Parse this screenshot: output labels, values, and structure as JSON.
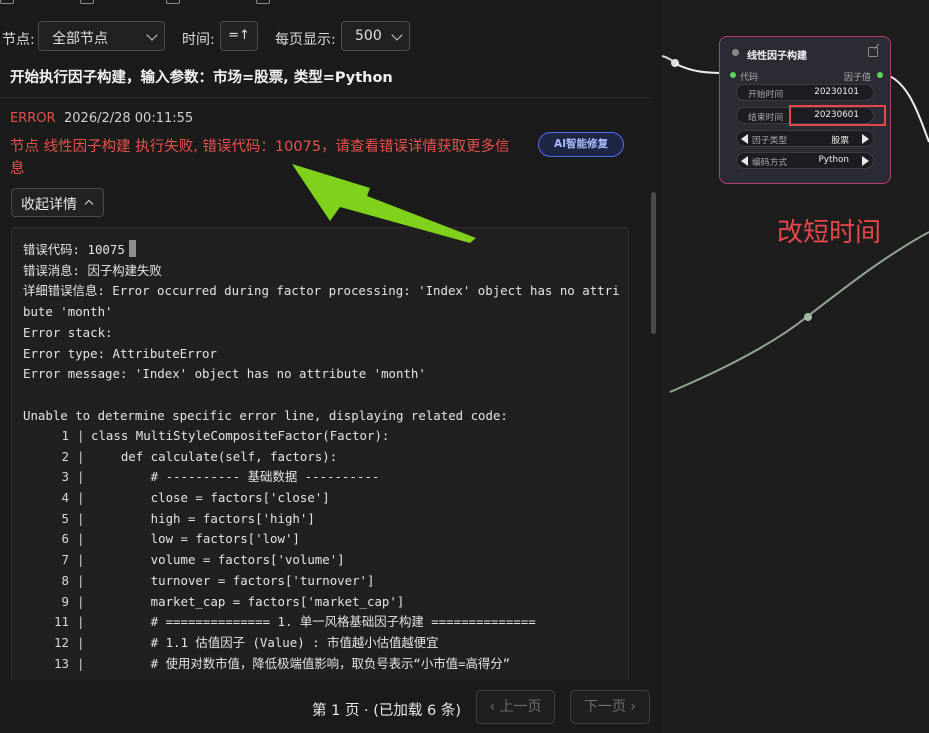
{
  "filter_bar": {
    "node_label": "节点:",
    "node_select_value": "全部节点",
    "time_label": "时间:",
    "sort_icon_text": "=↑",
    "page_size_label": "每页显示:",
    "page_size_value": "500"
  },
  "log": {
    "header_text": "开始执行因子构建，输入参数：市场=股票, 类型=Python",
    "error": {
      "level": "ERROR",
      "timestamp": "2026/2/28 00:11:55",
      "message": "节点 线性因子构建 执行失败, 错误代码：10075，请查看错误详情获取更多信息",
      "ai_fix_label": "AI智能修复",
      "collapse_label": "收起详情"
    },
    "detail_text": "错误代码: 10075\n错误消息: 因子构建失败\n详细错误信息: Error occurred during factor processing: 'Index' object has no attribute 'month'\nError stack:\nError type: AttributeError\nError message: 'Index' object has no attribute 'month'\n\nUnable to determine specific error line, displaying related code:",
    "code_lines": [
      {
        "n": "1",
        "code": "class MultiStyleCompositeFactor(Factor):"
      },
      {
        "n": "2",
        "code": "    def calculate(self, factors):"
      },
      {
        "n": "3",
        "code": "        # ---------- 基础数据 ----------"
      },
      {
        "n": "4",
        "code": "        close = factors['close']"
      },
      {
        "n": "5",
        "code": "        high = factors['high']"
      },
      {
        "n": "6",
        "code": "        low = factors['low']"
      },
      {
        "n": "7",
        "code": "        volume = factors['volume']"
      },
      {
        "n": "8",
        "code": "        turnover = factors['turnover']"
      },
      {
        "n": "9",
        "code": "        market_cap = factors['market_cap']"
      },
      {
        "n": "11",
        "code": "        # ============== 1. 单一风格基础因子构建 =============="
      },
      {
        "n": "12",
        "code": "        # 1.1 估值因子 (Value) : 市值越小估值越便宜"
      },
      {
        "n": "13",
        "code": "        # 使用对数市值，降低极端值影响，取负号表示“小市值=高得分”"
      }
    ]
  },
  "pager": {
    "page_info": "第 1 页 · (已加载 6 条)",
    "prev_label": "‹ 上一页",
    "next_label": "下一页 ›"
  },
  "node": {
    "title": "线性因子构建",
    "input_port": "代码",
    "output_port": "因子值",
    "rows": [
      {
        "label": "开始时间",
        "value": "20230101"
      },
      {
        "label": "结束时间",
        "value": "20230601"
      },
      {
        "label": "因子类型",
        "value": "股票"
      },
      {
        "label": "编码方式",
        "value": "Python"
      }
    ]
  },
  "annotation_text": "改短时间",
  "colors": {
    "error_red": "#e6514c",
    "node_border": "#b33a78",
    "arrow_green": "#7fd11c",
    "port_green": "#5fd35f",
    "annotation_red": "#e8474a"
  }
}
